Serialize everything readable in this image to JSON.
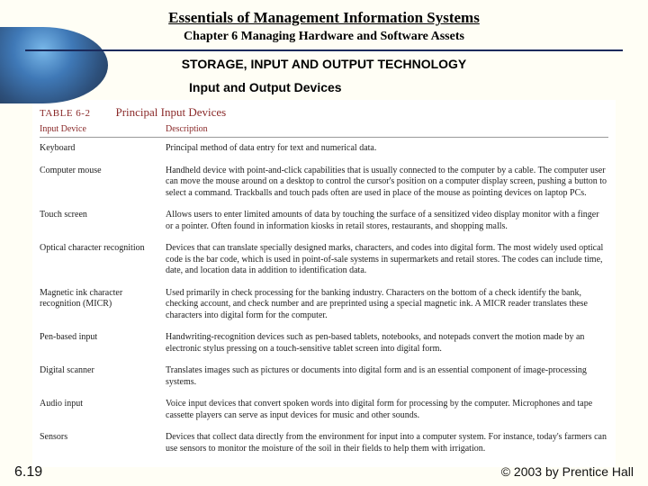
{
  "header": {
    "title": "Essentials of Management Information Systems",
    "chapter": "Chapter 6 Managing Hardware and Software Assets",
    "section": "STORAGE, INPUT AND OUTPUT TECHNOLOGY",
    "subsection": "Input and Output Devices"
  },
  "table": {
    "label": "TABLE 6-2",
    "title": "Principal Input Devices",
    "columns": [
      "Input Device",
      "Description"
    ],
    "rows": [
      {
        "device": "Keyboard",
        "desc": "Principal method of data entry for text and numerical data."
      },
      {
        "device": "Computer mouse",
        "desc": "Handheld device with point-and-click capabilities that is usually connected to the computer by a cable. The computer user can move the mouse around on a desktop to control the cursor's position on a computer display screen, pushing a button to select a command. Trackballs and touch pads often are used in place of the mouse as pointing devices on laptop PCs."
      },
      {
        "device": "Touch screen",
        "desc": "Allows users to enter limited amounts of data by touching the surface of a sensitized video display monitor with a finger or a pointer. Often found in information kiosks in retail stores, restaurants, and shopping malls."
      },
      {
        "device": "Optical character recognition",
        "desc": "Devices that can translate specially designed marks, characters, and codes into digital form. The most widely used optical code is the bar code, which is used in point-of-sale systems in supermarkets and retail stores. The codes can include time, date, and location data in addition to identification data."
      },
      {
        "device": "Magnetic ink character recognition (MICR)",
        "desc": "Used primarily in check processing for the banking industry. Characters on the bottom of a check identify the bank, checking account, and check number and are preprinted using a special magnetic ink. A MICR reader translates these characters into digital form for the computer."
      },
      {
        "device": "Pen-based input",
        "desc": "Handwriting-recognition devices such as pen-based tablets, notebooks, and notepads convert the motion made by an electronic stylus pressing on a touch-sensitive tablet screen into digital form."
      },
      {
        "device": "Digital scanner",
        "desc": "Translates images such as pictures or documents into digital form and is an essential component of image-processing systems."
      },
      {
        "device": "Audio input",
        "desc": "Voice input devices that convert spoken words into digital form for processing by the computer. Microphones and tape cassette players can serve as input devices for music and other sounds."
      },
      {
        "device": "Sensors",
        "desc": "Devices that collect data directly from the environment for input into a computer system. For instance, today's farmers can use sensors to monitor the moisture of the soil in their fields to help them with irrigation."
      }
    ]
  },
  "footer": {
    "page": "6.19",
    "copyright": "© 2003 by Prentice Hall"
  }
}
